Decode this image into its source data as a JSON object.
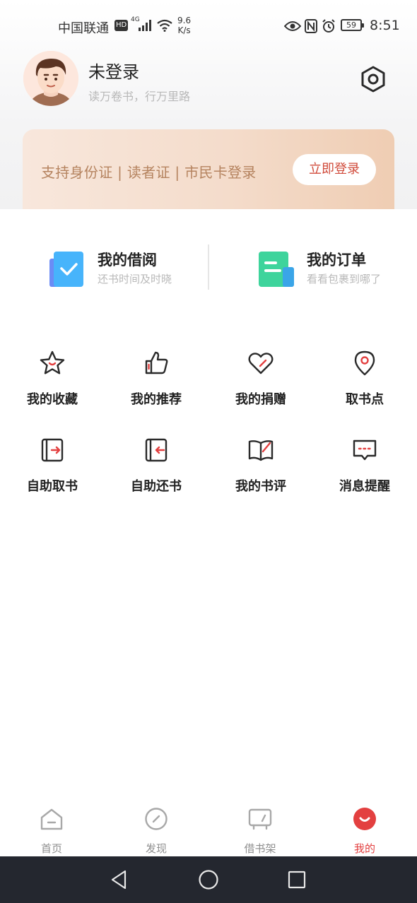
{
  "status_bar": {
    "carrier": "中国联通",
    "hd": "HD",
    "network": "4G",
    "speed_value": "9.6",
    "speed_unit": "K/s",
    "battery": "59",
    "time": "8:51"
  },
  "profile": {
    "login_status": "未登录",
    "motto": "读万卷书，行万里路"
  },
  "banner": {
    "text": "支持身份证 | 读者证 | 市民卡登录",
    "login_button": "立即登录"
  },
  "quick_links": [
    {
      "title": "我的借阅",
      "subtitle": "还书时间及时晓"
    },
    {
      "title": "我的订单",
      "subtitle": "看看包裹到哪了"
    }
  ],
  "grid": [
    {
      "label": "我的收藏",
      "icon": "star-icon"
    },
    {
      "label": "我的推荐",
      "icon": "thumbs-up-icon"
    },
    {
      "label": "我的捐赠",
      "icon": "heart-icon"
    },
    {
      "label": "取书点",
      "icon": "location-pin-icon"
    },
    {
      "label": "自助取书",
      "icon": "self-pickup-icon"
    },
    {
      "label": "自助还书",
      "icon": "self-return-icon"
    },
    {
      "label": "我的书评",
      "icon": "book-review-icon"
    },
    {
      "label": "消息提醒",
      "icon": "message-icon"
    }
  ],
  "tabs": [
    {
      "label": "首页",
      "icon": "home-icon"
    },
    {
      "label": "发现",
      "icon": "compass-icon"
    },
    {
      "label": "借书架",
      "icon": "bookshelf-icon"
    },
    {
      "label": "我的",
      "icon": "profile-icon",
      "active": true
    }
  ],
  "colors": {
    "accent": "#e34040",
    "banner_text": "#b5835f",
    "quick_blue": "#4aa8f8",
    "quick_green": "#3fd0a0"
  }
}
